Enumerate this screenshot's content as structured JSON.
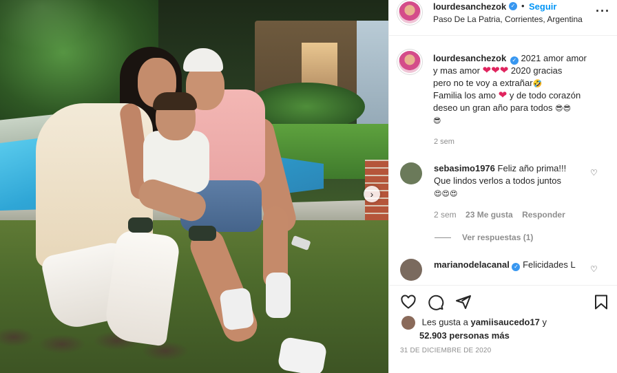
{
  "post": {
    "username": "lourdesanchezok",
    "follow_label": "Seguir",
    "follow_separator": "•",
    "location": "Paso De La Patria, Corrientes, Argentina",
    "verified_icon": "verified-badge-icon"
  },
  "caption": {
    "username": "lourdesanchezok",
    "line1": "2021 amor amor",
    "line2a": "y mas amor",
    "line2b": "2020 gracias",
    "line3": "pero no te voy a extrañar",
    "line4": "Familia los amo",
    "line4b": "y de todo corazón",
    "line5": "deseo un gran año para todos",
    "time": "2 sem"
  },
  "comments": [
    {
      "username": "sebasimo1976",
      "text_line1": "Feliz año prima!!!",
      "text_line2": "Que lindos verlos a todos juntos",
      "time": "2 sem",
      "likes": "23 Me gusta",
      "reply_label": "Responder",
      "view_replies": "Ver respuestas (1)"
    },
    {
      "username": "marianodelacanal",
      "text": "Felicidades L"
    }
  ],
  "footer": {
    "likes_prefix": "Les gusta a",
    "likes_user": "yamiisaucedo17",
    "likes_connector": "y",
    "likes_count": "52.903 personas más",
    "date": "31 de diciembre de 2020"
  },
  "icons": {
    "heart": "heart-icon",
    "comment": "comment-icon",
    "share": "share-icon",
    "save": "bookmark-icon",
    "more": "more-options-icon",
    "next": "chevron-right-icon"
  },
  "colors": {
    "link_blue": "#0095f6",
    "verified_blue": "#3897f0",
    "secondary_text": "#8e8e8e",
    "heart_red": "#e0245e"
  }
}
